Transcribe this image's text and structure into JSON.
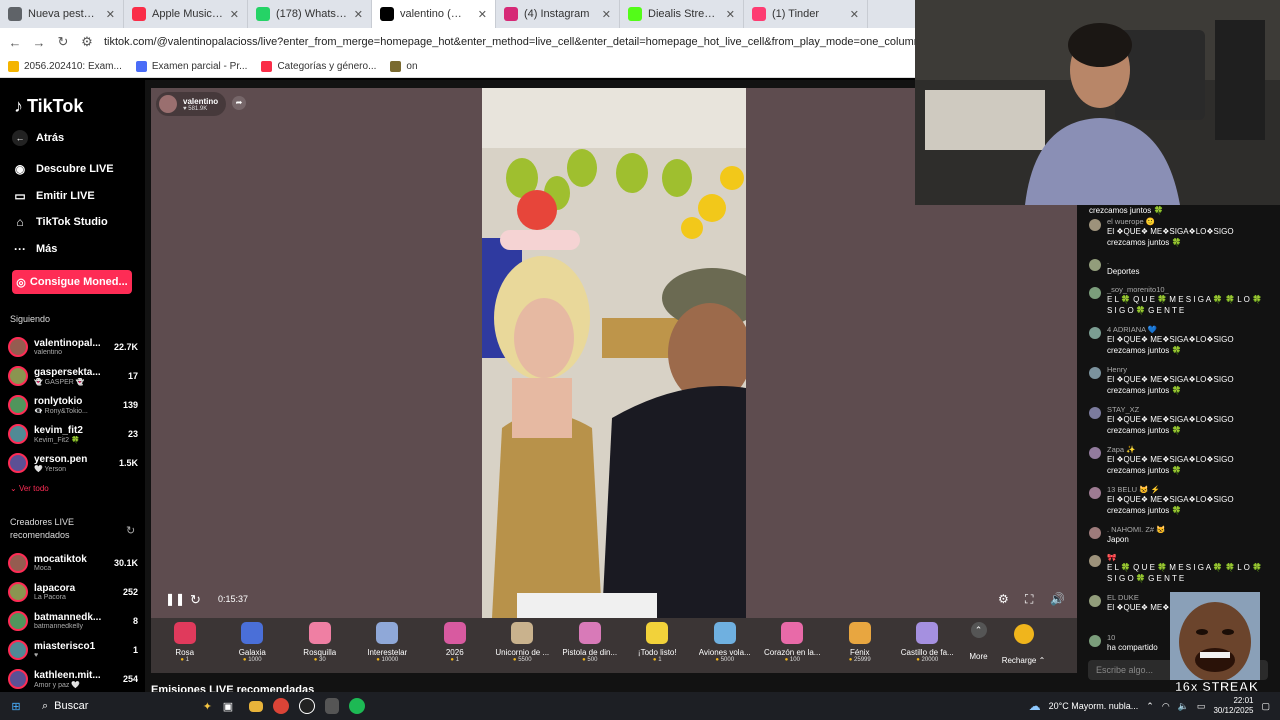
{
  "tabs": [
    {
      "label": "Nueva pestaña",
      "icon": "chrome-icon",
      "color": "#5f6368"
    },
    {
      "label": "Apple Music: reproduc",
      "icon": "apple-music-icon",
      "color": "#fa2d48"
    },
    {
      "label": "(178) WhatsApp",
      "icon": "whatsapp-icon",
      "color": "#25d366"
    },
    {
      "label": "valentino (@vale",
      "icon": "tiktok-icon",
      "color": "#000000",
      "active": true
    },
    {
      "label": "(4) Instagram",
      "icon": "instagram-icon",
      "color": "#d62976"
    },
    {
      "label": "Diealis Stream - Wat",
      "icon": "kick-icon",
      "color": "#53fc18"
    },
    {
      "label": "(1) Tinder",
      "icon": "tinder-icon",
      "color": "#fe3c72"
    }
  ],
  "address": {
    "url": "tiktok.com/@valentinopalacioss/live?enter_from_merge=homepage_hot&enter_method=live_cell&enter_detail=homepage_hot_live_cell&from_play_mode=one_column&is_guest_connect=0&is_"
  },
  "bookmarks": [
    {
      "label": "2056.202410: Exam...",
      "color": "#f4b400"
    },
    {
      "label": "Examen parcial - Pr...",
      "color": "#4a6cf7"
    },
    {
      "label": "Categorías y género...",
      "color": "#fa2d48"
    },
    {
      "label": "on",
      "color": "#7a6a30"
    }
  ],
  "sidebar": {
    "logo": "TikTok",
    "back": "Atrás",
    "nav": [
      {
        "label": "Descubre LIVE",
        "icon": "live-icon"
      },
      {
        "label": "Emitir LIVE",
        "icon": "broadcast-icon"
      },
      {
        "label": "TikTok Studio",
        "icon": "home-icon"
      },
      {
        "label": "Más",
        "icon": "more-icon"
      }
    ],
    "coins_button": "Consigue Moned...",
    "following_title": "Siguiendo",
    "following": [
      {
        "name": "valentinopal...",
        "sub": "valentino",
        "count": "22.7K"
      },
      {
        "name": "gaspersekta...",
        "sub": "👻 GASPER 👻",
        "count": "17"
      },
      {
        "name": "ronlytokio",
        "sub": "👁‍🗨 Rony&Tokio...",
        "count": "139"
      },
      {
        "name": "kevim_fit2",
        "sub": "Kevim_Fit2 🍀",
        "count": "23"
      },
      {
        "name": "yerson.pen",
        "sub": "🤍 Yerson",
        "count": "1.5K"
      }
    ],
    "see_all": "Ver todo",
    "recommended_title": "Creadores LIVE recomendados",
    "recommended": [
      {
        "name": "mocatiktok",
        "sub": "Moca",
        "count": "30.1K"
      },
      {
        "name": "lapacora",
        "sub": "La Pacora",
        "count": "252"
      },
      {
        "name": "batmannedk...",
        "sub": "batmannedkelly",
        "count": "8"
      },
      {
        "name": "miasterisco1",
        "sub": "♥",
        "count": "1"
      },
      {
        "name": "kathleen.mit...",
        "sub": "Amor y paz 🤍",
        "count": "254"
      }
    ]
  },
  "stream": {
    "host_name": "valentino",
    "host_likes": "581.9K",
    "time": "0:15:37"
  },
  "gifts": [
    {
      "name": "Rosa",
      "price": "1",
      "color": "#e03a5c"
    },
    {
      "name": "Galaxia",
      "price": "1000",
      "color": "#4a6fd8"
    },
    {
      "name": "Rosquilla",
      "price": "30",
      "color": "#ef7fa3"
    },
    {
      "name": "Interestelar",
      "price": "10000",
      "color": "#8fa8d8"
    },
    {
      "name": "2026",
      "price": "1",
      "color": "#d85aa0"
    },
    {
      "name": "Unicornio de ...",
      "price": "5500",
      "color": "#c9b28d"
    },
    {
      "name": "Pistola de din...",
      "price": "500",
      "color": "#d87ab8"
    },
    {
      "name": "¡Todo listo!",
      "price": "1",
      "color": "#f2d23a"
    },
    {
      "name": "Aviones vola...",
      "price": "5000",
      "color": "#6fb0e0"
    },
    {
      "name": "Corazón en la...",
      "price": "100",
      "color": "#e86aa8"
    },
    {
      "name": "Fénix",
      "price": "25999",
      "color": "#e8a640"
    },
    {
      "name": "Castillo de fa...",
      "price": "20000",
      "color": "#a590e0"
    }
  ],
  "gifts_more": "More",
  "recharge": "Recharge",
  "recommended_streams_title": "Emisiones LIVE recomendadas",
  "chat": [
    {
      "user": "",
      "text": "crezcamos juntos 🍀"
    },
    {
      "user": "el wuerope 🙂",
      "text": "El ❖QUE❖ ME❖SIGA❖LO❖SIGO crezcamos juntos 🍀"
    },
    {
      "user": ".",
      "text": "Deportes"
    },
    {
      "user": "_soy_morenito10_",
      "text": "E L 🍀 Q U E 🍀 M E S I G A 🍀 🍀 L O 🍀 S I G O 🍀 G E N T E"
    },
    {
      "user": "4 ADRIANA 💙",
      "text": "El ❖QUE❖ ME❖SIGA❖LO❖SIGO crezcamos juntos 🍀"
    },
    {
      "user": "Henry",
      "text": "El ❖QUE❖ ME❖SIGA❖LO❖SIGO crezcamos juntos 🍀"
    },
    {
      "user": "STAY_XZ",
      "text": "El ❖QUE❖ ME❖SIGA❖LO❖SIGO crezcamos juntos 🍀"
    },
    {
      "user": "Zapa ✨",
      "text": "El ❖QUE❖ ME❖SIGA❖LO❖SIGO crezcamos juntos 🍀"
    },
    {
      "user": "13 BELU 😺 ⚡",
      "text": "El ❖QUE❖ ME❖SIGA❖LO❖SIGO crezcamos juntos 🍀"
    },
    {
      "user": ". NAHOMI. Z# 😺",
      "text": "Japon"
    },
    {
      "user": "🎀",
      "text": "E L 🍀 Q U E 🍀 M E S I G A 🍀 🍀 L O 🍀 S I G O 🍀 G E N T E"
    },
    {
      "user": "EL DUKE",
      "text": "El ❖QUE❖ ME❖SIGA crezcamos junto"
    },
    {
      "user": "10",
      "text": "ha compartido"
    }
  ],
  "chat_placeholder": "Escribe algo...",
  "overlay_text": "16x STREAK",
  "taskbar": {
    "search": "Buscar",
    "weather": "20°C  Mayorm. nubla...",
    "time": "22:01",
    "date": "30/12/2025"
  }
}
